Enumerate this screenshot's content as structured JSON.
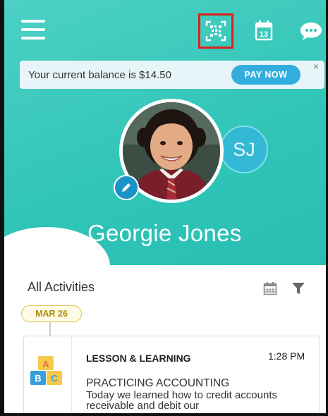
{
  "header": {
    "menu_icon": "hamburger-menu-icon",
    "qr_icon": "qr-code-icon",
    "calendar_icon": "calendar-icon",
    "calendar_day": "13",
    "chat_icon": "chat-bubble-icon",
    "qr_highlight_color": "#e0201b"
  },
  "banner": {
    "text": "Your current balance is $14.50",
    "pay_label": "PAY NOW",
    "close_label": "×"
  },
  "profile": {
    "name": "Georgie Jones",
    "secondary_initials": "SJ",
    "edit_icon": "pencil-icon"
  },
  "activities": {
    "title": "All Activities",
    "date_label": "MAR 26",
    "items": [
      {
        "type": "LESSON & LEARNING",
        "time": "1:28 PM",
        "title": "PRACTICING ACCOUNTING",
        "body": "Today we learned how to credit accounts receivable and debit our",
        "icon": "abc-blocks-icon"
      }
    ]
  },
  "colors": {
    "hero": "#2ec4b6",
    "accent_blue": "#34aede",
    "date_pill": "#e0c24a"
  }
}
